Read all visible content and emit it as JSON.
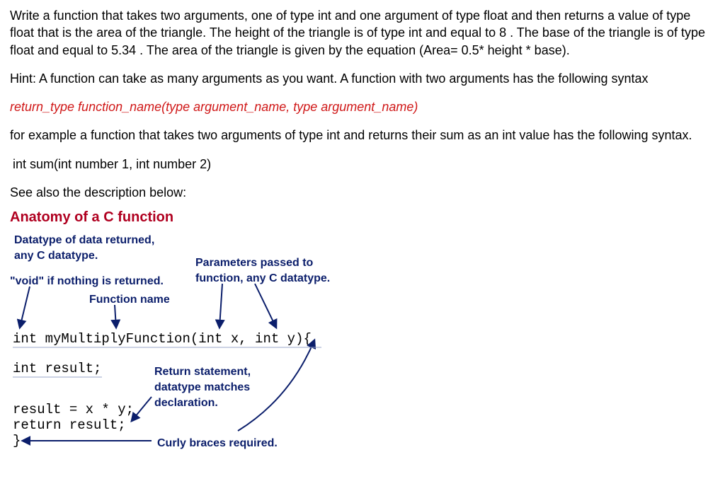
{
  "paragraphs": {
    "p1": "Write a function that takes two arguments, one of type int and one argument of type float and then returns a value of type float that is the area of the triangle. The height of the triangle is of type int and equal to 8 . The base of the triangle is of type float and equal to 5.34 .  The area of the triangle is given by the equation (Area= 0.5* height * base).",
    "p2": "Hint: A function can take as many arguments as you want. A function with two arguments has the following syntax",
    "p3": "return_type function_name(type argument_name, type argument_name)",
    "p4": "for example a function that takes two arguments of type int and returns their sum as an int value has the following syntax.",
    "p5": "int sum(int number 1, int number 2)",
    "p6": "See also the description below:"
  },
  "anatomy": {
    "title": "Anatomy of a C function",
    "label_datatype_line1": "Datatype of data returned,",
    "label_datatype_line2": "any C datatype.",
    "label_void": "\"void\" if nothing is returned.",
    "label_funcname": "Function name",
    "label_params_line1": "Parameters passed to",
    "label_params_line2": "function, any C datatype.",
    "label_return_line1": "Return statement,",
    "label_return_line2": "datatype matches",
    "label_return_line3": "declaration.",
    "label_curly": "Curly braces required.",
    "code_line1": "int myMultiplyFunction(int x, int y){",
    "code_line2": "int result;",
    "code_line3": "result = x * y;",
    "code_line4": "return result;",
    "code_line5": "}"
  }
}
